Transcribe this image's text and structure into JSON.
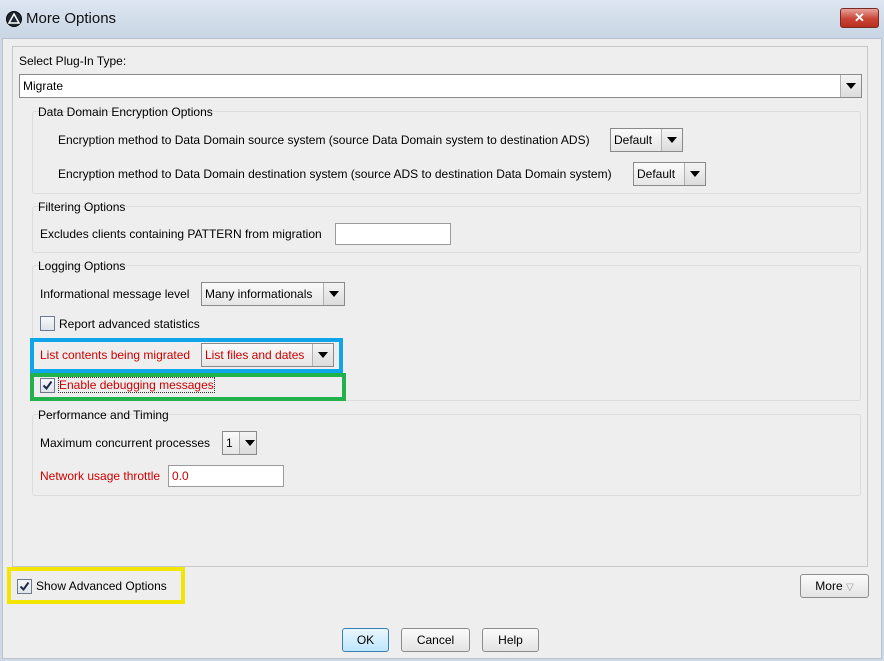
{
  "window": {
    "title": "More Options",
    "close_glyph": "✕"
  },
  "plugin": {
    "label": "Select Plug-In Type:",
    "value": "Migrate"
  },
  "encryption": {
    "title": "Data Domain Encryption Options",
    "source_label": "Encryption method to Data Domain source system (source Data Domain system to destination ADS)",
    "source_value": "Default",
    "dest_label": "Encryption method to Data Domain destination system (source ADS to destination Data Domain system)",
    "dest_value": "Default"
  },
  "filtering": {
    "title": "Filtering Options",
    "exclude_label": "Excludes clients containing PATTERN from migration",
    "exclude_value": ""
  },
  "logging": {
    "title": "Logging Options",
    "info_label": "Informational message level",
    "info_value": "Many informationals",
    "report_label": "Report advanced statistics",
    "report_checked": false,
    "list_label": "List contents being migrated",
    "list_value": "List files and dates",
    "debug_label": "Enable debugging messages",
    "debug_checked": true
  },
  "performance": {
    "title": "Performance and Timing",
    "max_label": "Maximum concurrent processes",
    "max_value": "1",
    "throttle_label": "Network usage throttle",
    "throttle_value": "0.0"
  },
  "footer": {
    "show_advanced_label": "Show Advanced Options",
    "show_advanced_checked": true,
    "more_label": "More",
    "ok_label": "OK",
    "cancel_label": "Cancel",
    "help_label": "Help"
  },
  "colors": {
    "required_label": "#cc0000",
    "highlight_blue": "#0ea5e9",
    "highlight_green": "#22b14c",
    "highlight_yellow": "#f2e600"
  },
  "icons": [
    "app-logo-icon",
    "close-icon",
    "dropdown-arrow-icon",
    "checkmark-icon",
    "more-chevron-icon"
  ]
}
